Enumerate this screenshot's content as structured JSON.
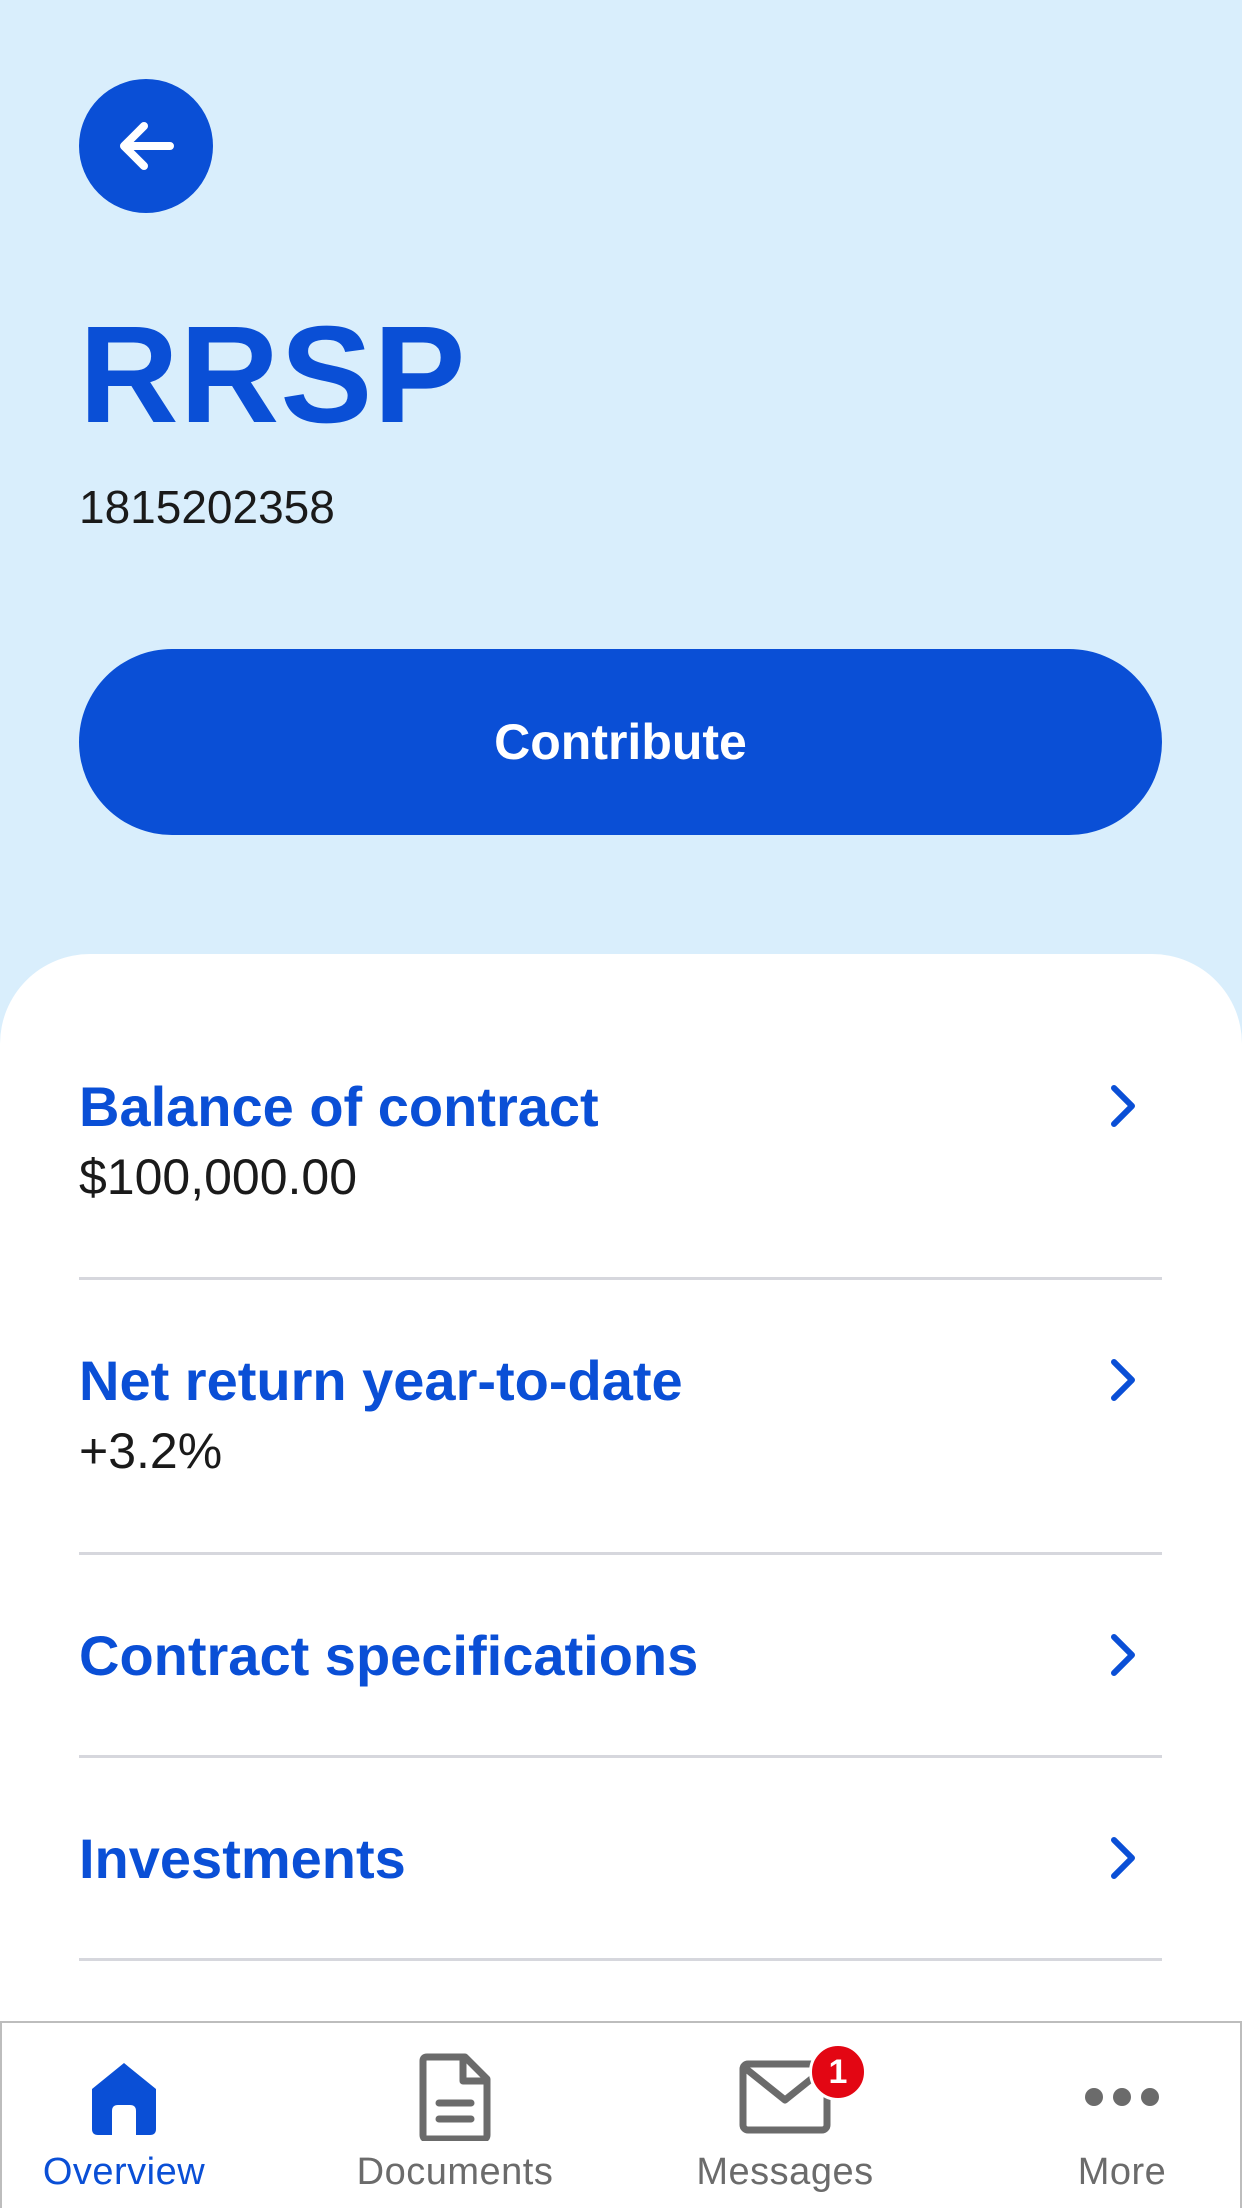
{
  "header": {
    "title": "RRSP",
    "account_number": "1815202358",
    "contribute_label": "Contribute",
    "back_icon": "arrow-left-icon"
  },
  "rows": [
    {
      "title": "Balance of contract",
      "value": "$100,000.00"
    },
    {
      "title": "Net return year-to-date",
      "value": "+3.2%"
    },
    {
      "title": "Contract specifications"
    },
    {
      "title": "Investments"
    }
  ],
  "tabbar": {
    "tabs": [
      {
        "label": "Overview",
        "icon": "home-icon",
        "active": true
      },
      {
        "label": "Documents",
        "icon": "document-icon"
      },
      {
        "label": "Messages",
        "icon": "mail-icon",
        "badge": "1"
      },
      {
        "label": "More",
        "icon": "more-icon"
      }
    ]
  },
  "colors": {
    "brand_blue": "#0a4fd6",
    "header_background": "#d9eefc",
    "badge_red": "#e30613"
  }
}
